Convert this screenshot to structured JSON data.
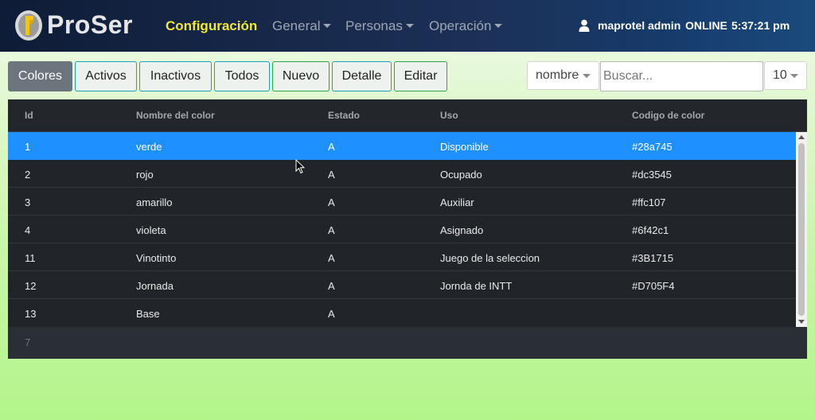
{
  "navbar": {
    "brand": "ProSer",
    "active_item": "Configuración",
    "menu": [
      {
        "label": "General"
      },
      {
        "label": "Personas"
      },
      {
        "label": "Operación"
      }
    ],
    "user": "maprotel admin",
    "status": "ONLINE",
    "time": "5:37:21 pm",
    "icons": {
      "logo": "proser-logo",
      "user": "user-icon"
    },
    "colors": {
      "active": "#f0e833",
      "menu": "#9ea6b4"
    }
  },
  "toolbar": {
    "buttons": [
      {
        "label": "Colores",
        "active": true
      },
      {
        "label": "Activos"
      },
      {
        "label": "Inactivos"
      },
      {
        "label": "Todos"
      },
      {
        "label": "Nuevo"
      },
      {
        "label": "Detalle"
      },
      {
        "label": "Editar"
      }
    ],
    "field_select": "nombre",
    "search_placeholder": "Buscar...",
    "page_size": "10"
  },
  "table": {
    "columns": [
      "Id",
      "Nombre del color",
      "Estado",
      "Uso",
      "Codigo de color"
    ],
    "rows": [
      {
        "id": "1",
        "name": "verde",
        "state": "A",
        "use": "Disponible",
        "code": "#28a745",
        "selected": true
      },
      {
        "id": "2",
        "name": "rojo",
        "state": "A",
        "use": "Ocupado",
        "code": "#dc3545"
      },
      {
        "id": "3",
        "name": "amarillo",
        "state": "A",
        "use": "Auxiliar",
        "code": "#ffc107"
      },
      {
        "id": "4",
        "name": "violeta",
        "state": "A",
        "use": "Asignado",
        "code": "#6f42c1"
      },
      {
        "id": "11",
        "name": "Vinotinto",
        "state": "A",
        "use": "Juego de la seleccion",
        "code": "#3B1715"
      },
      {
        "id": "12",
        "name": "Jornada",
        "state": "A",
        "use": "Jornda de INTT",
        "code": "#D705F4"
      },
      {
        "id": "13",
        "name": "Base",
        "state": "A",
        "use": "",
        "code": ""
      }
    ],
    "footer_count": "7",
    "selected_color": "#1e90ff"
  }
}
